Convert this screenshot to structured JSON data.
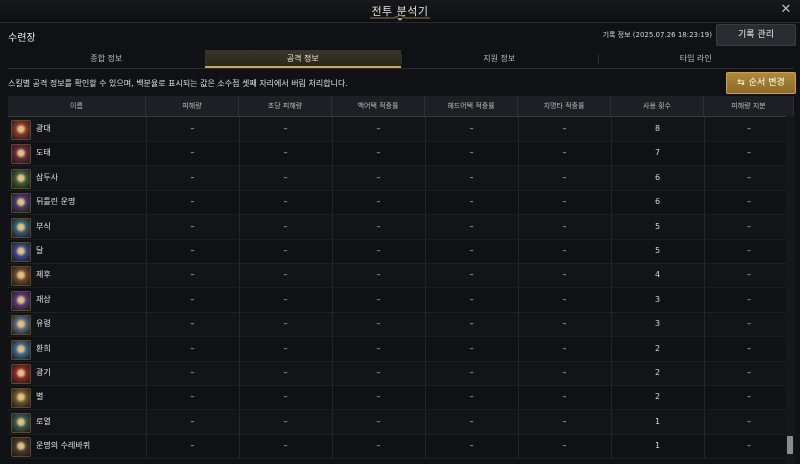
{
  "window": {
    "title": "전투 분석기"
  },
  "header": {
    "panel_name": "수련장",
    "record_info": "기록 정보 (2025.07.26 18:23:19)",
    "record_manage_label": "기록 관리"
  },
  "tabs": [
    "종합 정보",
    "공격 정보",
    "지원 정보",
    "타임 라인"
  ],
  "active_tab": 1,
  "hint_text": "스킬별 공격 정보를 확인할 수 있으며, 백분율로 표시되는 값은 소수점 셋째 자리에서 버림 처리합니다.",
  "order_button_label": "순서 변경",
  "columns": [
    "이름",
    "피해량",
    "초당 피해량",
    "백어택 적중률",
    "헤드어택 적중률",
    "치명타 적중률",
    "사용 횟수",
    "피해량 지분"
  ],
  "rows": [
    {
      "name": "광대",
      "cells": [
        "–",
        "–",
        "–",
        "–",
        "–",
        "8",
        "–"
      ],
      "icon_color": "#8a3b2a"
    },
    {
      "name": "도태",
      "cells": [
        "–",
        "–",
        "–",
        "–",
        "–",
        "7",
        "–"
      ],
      "icon_color": "#6b2d3a"
    },
    {
      "name": "삼두사",
      "cells": [
        "–",
        "–",
        "–",
        "–",
        "–",
        "6",
        "–"
      ],
      "icon_color": "#3f5b3a"
    },
    {
      "name": "뒤틀린 운명",
      "cells": [
        "–",
        "–",
        "–",
        "–",
        "–",
        "6",
        "–"
      ],
      "icon_color": "#4a3a6e"
    },
    {
      "name": "부식",
      "cells": [
        "–",
        "–",
        "–",
        "–",
        "–",
        "5",
        "–"
      ],
      "icon_color": "#3a5e72"
    },
    {
      "name": "달",
      "cells": [
        "–",
        "–",
        "–",
        "–",
        "–",
        "5",
        "–"
      ],
      "icon_color": "#3e4a8a"
    },
    {
      "name": "제후",
      "cells": [
        "–",
        "–",
        "–",
        "–",
        "–",
        "4",
        "–"
      ],
      "icon_color": "#6e4a2a"
    },
    {
      "name": "재상",
      "cells": [
        "–",
        "–",
        "–",
        "–",
        "–",
        "3",
        "–"
      ],
      "icon_color": "#5a3a7a"
    },
    {
      "name": "유령",
      "cells": [
        "–",
        "–",
        "–",
        "–",
        "–",
        "3",
        "–"
      ],
      "icon_color": "#5a6a7a"
    },
    {
      "name": "환희",
      "cells": [
        "–",
        "–",
        "–",
        "–",
        "–",
        "2",
        "–"
      ],
      "icon_color": "#3a6a8a"
    },
    {
      "name": "광기",
      "cells": [
        "–",
        "–",
        "–",
        "–",
        "–",
        "2",
        "–"
      ],
      "icon_color": "#8a2a2a"
    },
    {
      "name": "별",
      "cells": [
        "–",
        "–",
        "–",
        "–",
        "–",
        "2",
        "–"
      ],
      "icon_color": "#6a5a2a"
    },
    {
      "name": "로열",
      "cells": [
        "–",
        "–",
        "–",
        "–",
        "–",
        "1",
        "–"
      ],
      "icon_color": "#3a5a4a"
    },
    {
      "name": "운명의 수레바퀴",
      "cells": [
        "–",
        "–",
        "–",
        "–",
        "–",
        "1",
        "–"
      ],
      "icon_color": "#4a3a2a"
    }
  ]
}
